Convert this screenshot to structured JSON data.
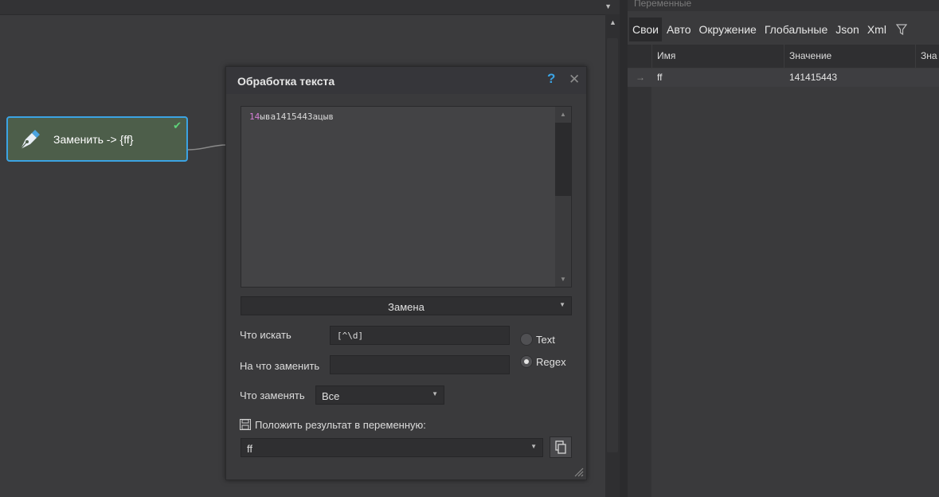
{
  "canvas": {
    "node": {
      "label": "Заменить -> {ff}",
      "status": "check-icon"
    }
  },
  "dialog": {
    "title": "Обработка текста",
    "help": "?",
    "close": "✕",
    "text_prefix": "14",
    "text_rest": "ыва1415443ацыв",
    "mode": "Замена",
    "search_label": "Что искать",
    "search_value": "[^\\d]",
    "replace_label": "На что заменить",
    "replace_value": "",
    "option_text": "Text",
    "option_regex": "Regex",
    "what_replace_label": "Что заменять",
    "what_replace_value": "Все",
    "save_label": "Положить результат в переменную:",
    "variable": "ff"
  },
  "variables_panel": {
    "title": "Переменные",
    "tabs": [
      "Свои",
      "Авто",
      "Окружение",
      "Глобальные",
      "Json",
      "Xml"
    ],
    "active_tab": "Свои",
    "columns": [
      "Имя",
      "Значение",
      "Зна"
    ],
    "rows": [
      {
        "name": "ff",
        "value": "141415443"
      }
    ]
  },
  "colors": {
    "accent": "#3ba3e3",
    "node_bg": "#4d5e4a",
    "highlight_text": "#d57fd6",
    "check": "#5fd37a"
  }
}
